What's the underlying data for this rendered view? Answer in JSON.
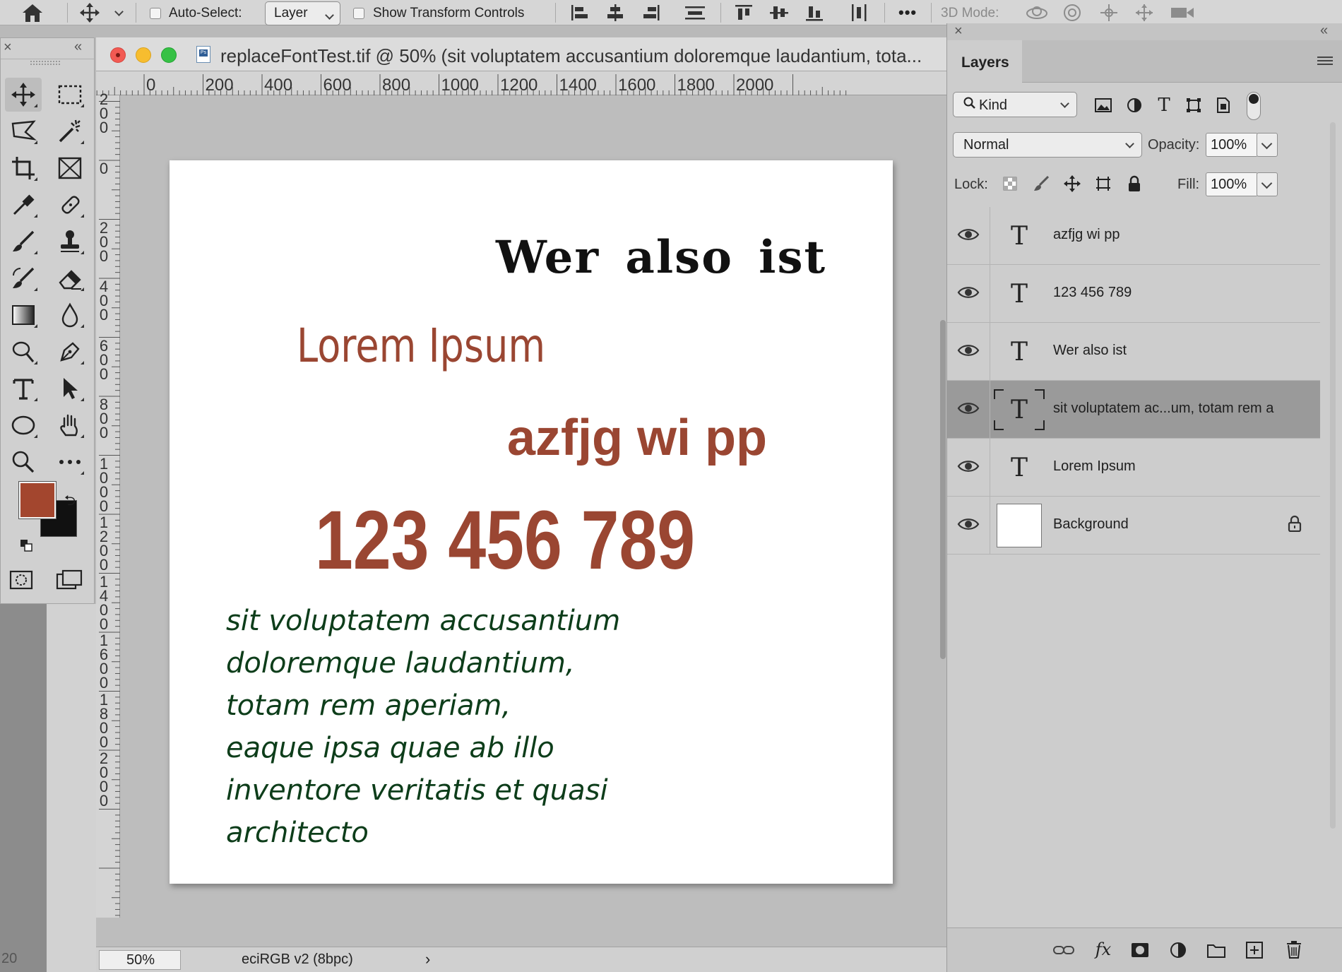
{
  "options_bar": {
    "auto_select_label": "Auto-Select:",
    "auto_select_target": "Layer",
    "show_transform_label": "Show Transform Controls",
    "more_label": "•••",
    "mode_3d_label": "3D Mode:"
  },
  "document": {
    "title": "replaceFontTest.tif @ 50% (sit voluptatem accusantium  doloremque laudantium,  tota...",
    "ruler_h_labels": [
      "0",
      "200",
      "400",
      "600",
      "800",
      "1000",
      "1200",
      "1400",
      "1600",
      "1800",
      "2000"
    ],
    "ruler_v_labels": [
      "200",
      "0",
      "200",
      "400",
      "600",
      "800",
      "1000",
      "1200",
      "1400",
      "1600",
      "1800",
      "2000"
    ],
    "zoom": "50%",
    "color_profile": "eciRGB v2 (8bpc)",
    "status_arrow": "›",
    "left_strip_number": "20"
  },
  "canvas": {
    "heading": "Wer also ist",
    "lorem": "Lorem Ipsum",
    "azfjg": "azfjg wi pp",
    "numbers": "123 456 789",
    "paragraph_lines": [
      "sit voluptatem accusantium",
      "doloremque laudantium,",
      "totam rem aperiam,",
      "eaque ipsa quae ab illo",
      "inventore veritatis et quasi",
      "architecto"
    ],
    "colors": {
      "rust": "#9a4632",
      "green": "#0d3d1a",
      "black": "#111111"
    }
  },
  "tools": {
    "foreground_color": "#a3462e",
    "background_color": "#111111"
  },
  "layers_panel": {
    "tab_label": "Layers",
    "filter_kind": "Kind",
    "blend_mode": "Normal",
    "opacity_label": "Opacity:",
    "opacity_value": "100%",
    "lock_label": "Lock:",
    "fill_label": "Fill:",
    "fill_value": "100%",
    "layers": [
      {
        "name": "azfjg wi pp",
        "type": "text",
        "visible": true,
        "selected": false
      },
      {
        "name": "123 456 789",
        "type": "text",
        "visible": true,
        "selected": false
      },
      {
        "name": "Wer also ist",
        "type": "text",
        "visible": true,
        "selected": false
      },
      {
        "name": "sit voluptatem ac...um,  totam rem a",
        "type": "text",
        "visible": true,
        "selected": true
      },
      {
        "name": "Lorem Ipsum",
        "type": "text",
        "visible": true,
        "selected": false
      },
      {
        "name": "Background",
        "type": "image",
        "visible": true,
        "selected": false,
        "locked": true
      }
    ]
  }
}
